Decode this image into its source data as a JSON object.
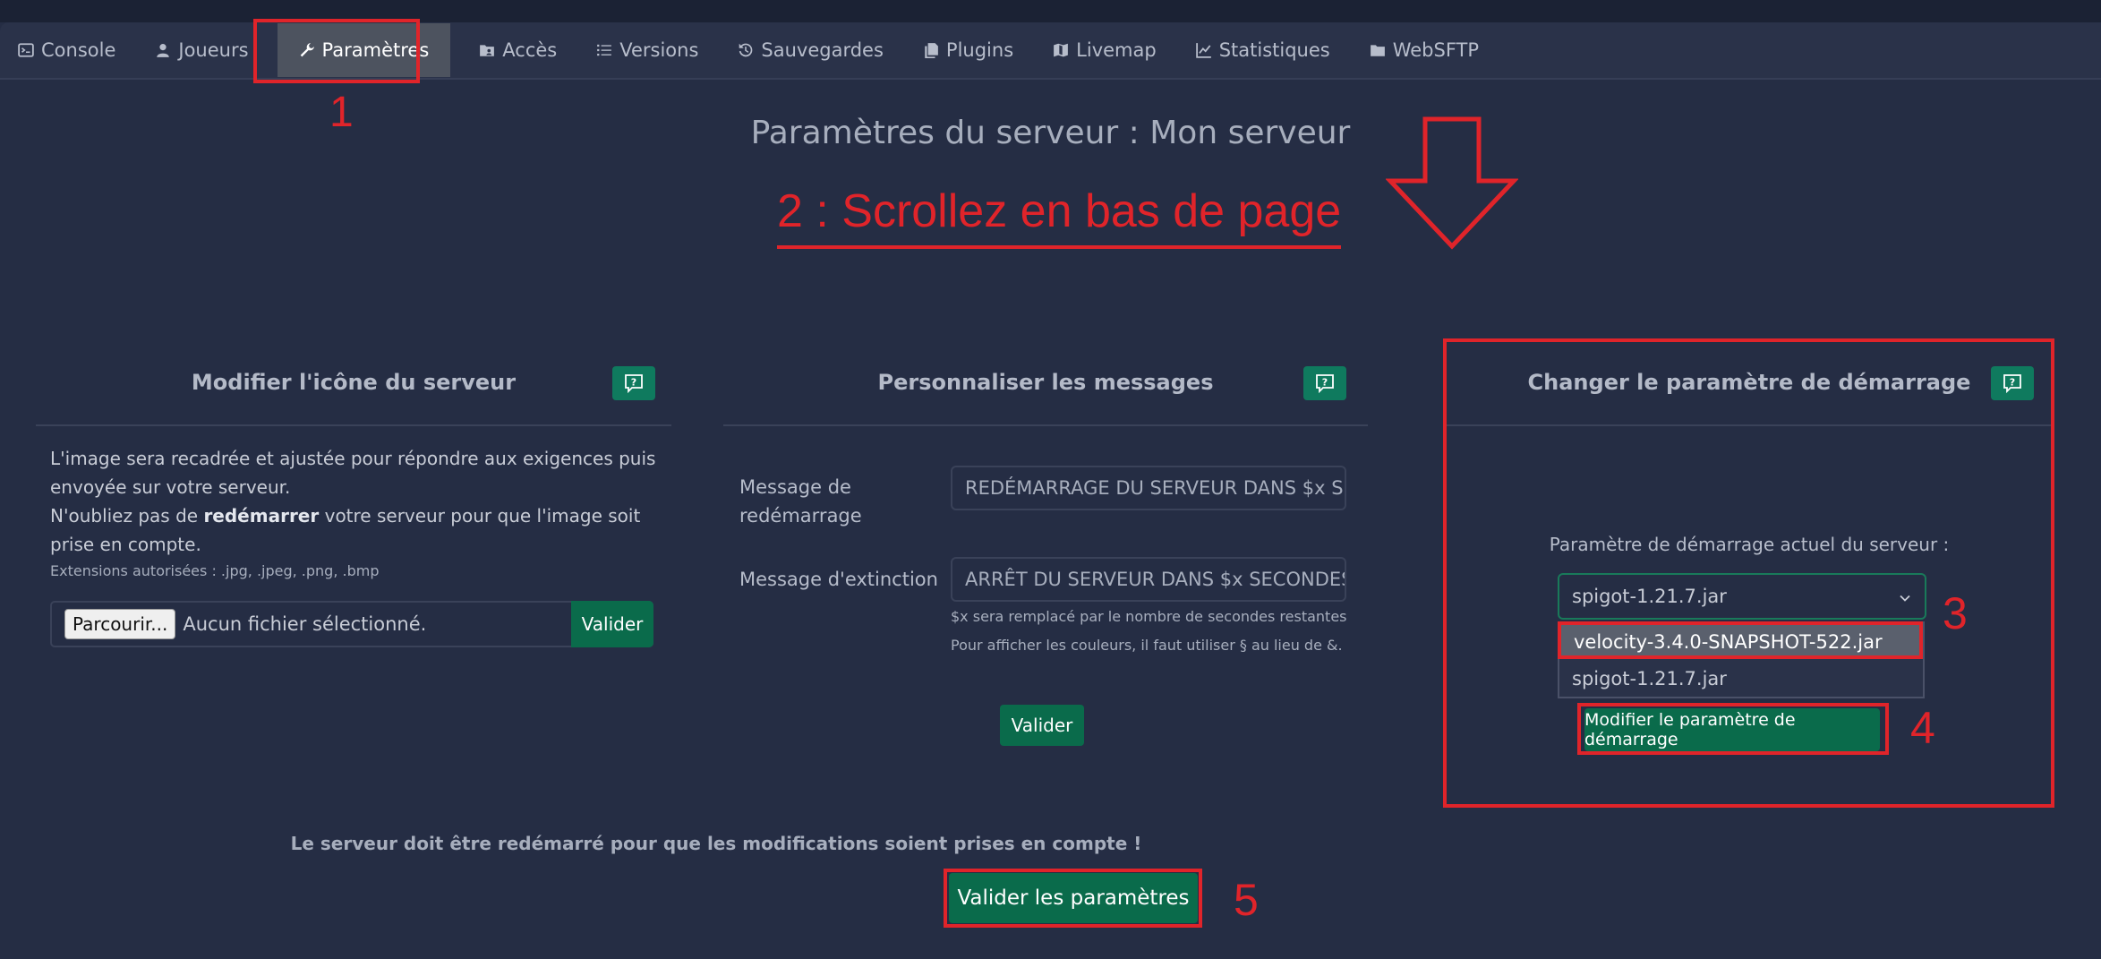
{
  "nav": {
    "tabs": [
      {
        "label": "Console",
        "icon": "terminal-icon"
      },
      {
        "label": "Joueurs",
        "icon": "user-icon"
      },
      {
        "label": "Paramètres",
        "icon": "wrench-icon"
      },
      {
        "label": "Accès",
        "icon": "folder-user-icon"
      },
      {
        "label": "Versions",
        "icon": "list-icon"
      },
      {
        "label": "Sauvegardes",
        "icon": "history-icon"
      },
      {
        "label": "Plugins",
        "icon": "file-icon"
      },
      {
        "label": "Livemap",
        "icon": "map-icon"
      },
      {
        "label": "Statistiques",
        "icon": "chart-icon"
      },
      {
        "label": "WebSFTP",
        "icon": "folder-icon"
      }
    ],
    "active": "Paramètres"
  },
  "page": {
    "title": "Paramètres du serveur : Mon serveur"
  },
  "annotations": {
    "step1": "1",
    "step2": "2 : Scrollez en bas de page",
    "step3": "3",
    "step4": "4",
    "step5": "5",
    "color": "#e0242a"
  },
  "icon_panel": {
    "title": "Modifier l'icône du serveur",
    "text1": "L'image sera recadrée et ajustée pour répondre aux exigences puis envoyée sur votre serveur.",
    "text2_before": "N'oubliez pas de ",
    "text2_bold": "redémarrer",
    "text2_after": " votre serveur pour que l'image soit prise en compte.",
    "extensions": "Extensions autorisées : .jpg, .jpeg, .png, .bmp",
    "browse_label": "Parcourir...",
    "no_file": "Aucun fichier sélectionné.",
    "validate_label": "Valider"
  },
  "messages_panel": {
    "title": "Personnaliser les messages",
    "restart_label": "Message de redémarrage",
    "restart_value": "REDÉMARRAGE DU SERVEUR DANS $x SECONDES",
    "shutdown_label": "Message d'extinction",
    "shutdown_value": "ARRÊT DU SERVEUR DANS $x SECONDES",
    "hint1": "$x sera remplacé par le nombre de secondes restantes",
    "hint2": "Pour afficher les couleurs, il faut utiliser § au lieu de &.",
    "validate_label": "Valider"
  },
  "startup_panel": {
    "title": "Changer le paramètre de démarrage",
    "current_label": "Paramètre de démarrage actuel du serveur :",
    "selected": "spigot-1.21.7.jar",
    "options": [
      "velocity-3.4.0-SNAPSHOT-522.jar",
      "spigot-1.21.7.jar"
    ],
    "highlighted_option": "velocity-3.4.0-SNAPSHOT-522.jar",
    "modify_label": "Modifier le paramètre de démarrage"
  },
  "footer": {
    "note": "Le serveur doit être redémarré pour que les modifications soient prises en compte !",
    "save_label": "Valider les paramètres"
  },
  "colors": {
    "background": "#252d44",
    "accent_green": "#0a6b4b",
    "annotation_red": "#e0242a"
  }
}
